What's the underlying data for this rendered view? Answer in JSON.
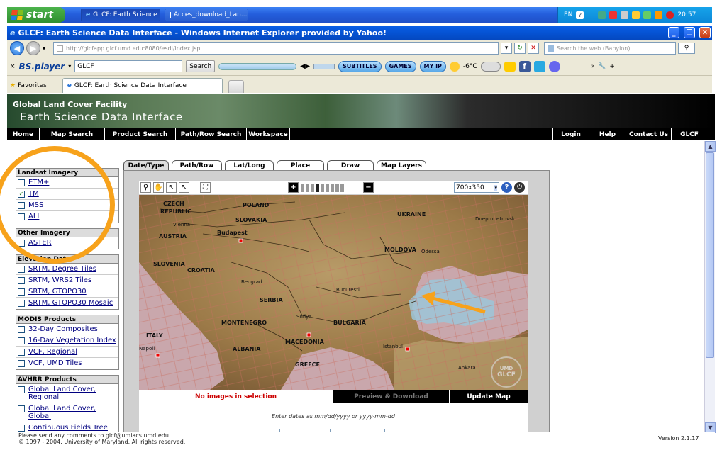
{
  "taskbar": {
    "start_label": "start",
    "tasks": [
      "GLCF: Earth Science ...",
      "Acces_download_Lan..."
    ],
    "tray_lang": "EN",
    "tray_time": "20:57"
  },
  "window": {
    "title": "GLCF: Earth Science Data Interface - Windows Internet Explorer provided by Yahoo!"
  },
  "address": {
    "url": "http://glcfapp.glcf.umd.edu:8080/esdi/index.jsp",
    "search_placeholder": "Search the web (Babylon)"
  },
  "toolbar": {
    "bsplayer": "BS.player",
    "input_value": "GLCF",
    "search_label": "Search",
    "subtitles": "SUBTITLES",
    "games": "GAMES",
    "myip": "MY IP",
    "temperature": "-6°C"
  },
  "favorites": {
    "label": "Favorites",
    "tab_title": "GLCF: Earth Science Data Interface"
  },
  "banner": {
    "line1": "Global Land Cover Facility",
    "line2": "Earth Science Data Interface"
  },
  "sitenav": {
    "left": [
      "Home",
      "Map Search",
      "Product Search",
      "Path/Row Search",
      "Workspace"
    ],
    "right": [
      "Login",
      "Help",
      "Contact Us",
      "GLCF"
    ]
  },
  "groups": [
    {
      "title": "Landsat Imagery",
      "items": [
        {
          "label": "ETM+",
          "checked": false
        },
        {
          "label": "TM",
          "checked": true
        },
        {
          "label": "MSS",
          "checked": false
        },
        {
          "label": "ALI",
          "checked": false
        }
      ]
    },
    {
      "title": "Other Imagery",
      "items": [
        {
          "label": "ASTER",
          "checked": false
        }
      ]
    },
    {
      "title": "Elevation Data",
      "items": [
        {
          "label": "SRTM, Degree Tiles",
          "checked": false
        },
        {
          "label": "SRTM, WRS2 Tiles",
          "checked": false
        },
        {
          "label": "SRTM, GTOPO30",
          "checked": false
        },
        {
          "label": "SRTM, GTOPO30 Mosaic",
          "checked": false
        }
      ]
    },
    {
      "title": "MODIS Products",
      "items": [
        {
          "label": "32-Day Composites",
          "checked": false
        },
        {
          "label": "16-Day Vegetation Index",
          "checked": false
        },
        {
          "label": "VCF, Regional",
          "checked": false
        },
        {
          "label": "VCF, UMD Tiles",
          "checked": false
        }
      ]
    },
    {
      "title": "AVHRR Products",
      "items": [
        {
          "label": "Global Land Cover, Regional",
          "checked": false
        },
        {
          "label": "Global Land Cover, Global",
          "checked": false
        },
        {
          "label": "Continuous Fields Tree",
          "checked": false
        }
      ]
    }
  ],
  "tabs": [
    "Date/Type",
    "Path/Row",
    "Lat/Long",
    "Place",
    "Draw",
    "Map Layers"
  ],
  "map": {
    "size_select": "700x350",
    "labels": [
      {
        "text": "CZECH",
        "cls": ""
      },
      {
        "text": "REPUBLIC",
        "cls": ""
      },
      {
        "text": "POLAND",
        "cls": ""
      },
      {
        "text": "UKRAINE",
        "cls": ""
      },
      {
        "text": "Vienna",
        "cls": "sm"
      },
      {
        "text": "SLOVAKIA",
        "cls": ""
      },
      {
        "text": "Dnepropetrovsk",
        "cls": "sm"
      },
      {
        "text": "AUSTRIA",
        "cls": ""
      },
      {
        "text": "Budapest",
        "cls": ""
      },
      {
        "text": "MOLDOVA",
        "cls": ""
      },
      {
        "text": "Odessa",
        "cls": "sm"
      },
      {
        "text": "SLOVENIA",
        "cls": ""
      },
      {
        "text": "CROATIA",
        "cls": ""
      },
      {
        "text": "Beograd",
        "cls": "sm"
      },
      {
        "text": "Bucuresti",
        "cls": "sm"
      },
      {
        "text": "SERBIA",
        "cls": ""
      },
      {
        "text": "Sofiya",
        "cls": "sm"
      },
      {
        "text": "MONTENEGRO",
        "cls": ""
      },
      {
        "text": "BULGARIA",
        "cls": ""
      },
      {
        "text": "ITALY",
        "cls": ""
      },
      {
        "text": "MACEDONIA",
        "cls": ""
      },
      {
        "text": "Napoli",
        "cls": "sm"
      },
      {
        "text": "ALBANIA",
        "cls": ""
      },
      {
        "text": "Istanbul",
        "cls": "sm"
      },
      {
        "text": "GREECE",
        "cls": ""
      },
      {
        "text": "Ankara",
        "cls": "sm"
      }
    ],
    "logo_top": "UMD",
    "logo_bottom": "GLCF"
  },
  "status": {
    "message": "No images in selection",
    "preview": "Preview & Download",
    "update": "Update Map"
  },
  "form": {
    "hint": "Enter dates as mm/dd/yyyy or yyyy-mm-dd"
  },
  "footer": {
    "line1": "Please send any comments to glcf@umiacs.umd.edu",
    "line2": "© 1997 - 2004. University of Maryland. All rights reserved.",
    "version": "Version 2.1.17"
  },
  "colors": {
    "annotation": "#f7a21b",
    "status_red": "#cc0000"
  }
}
